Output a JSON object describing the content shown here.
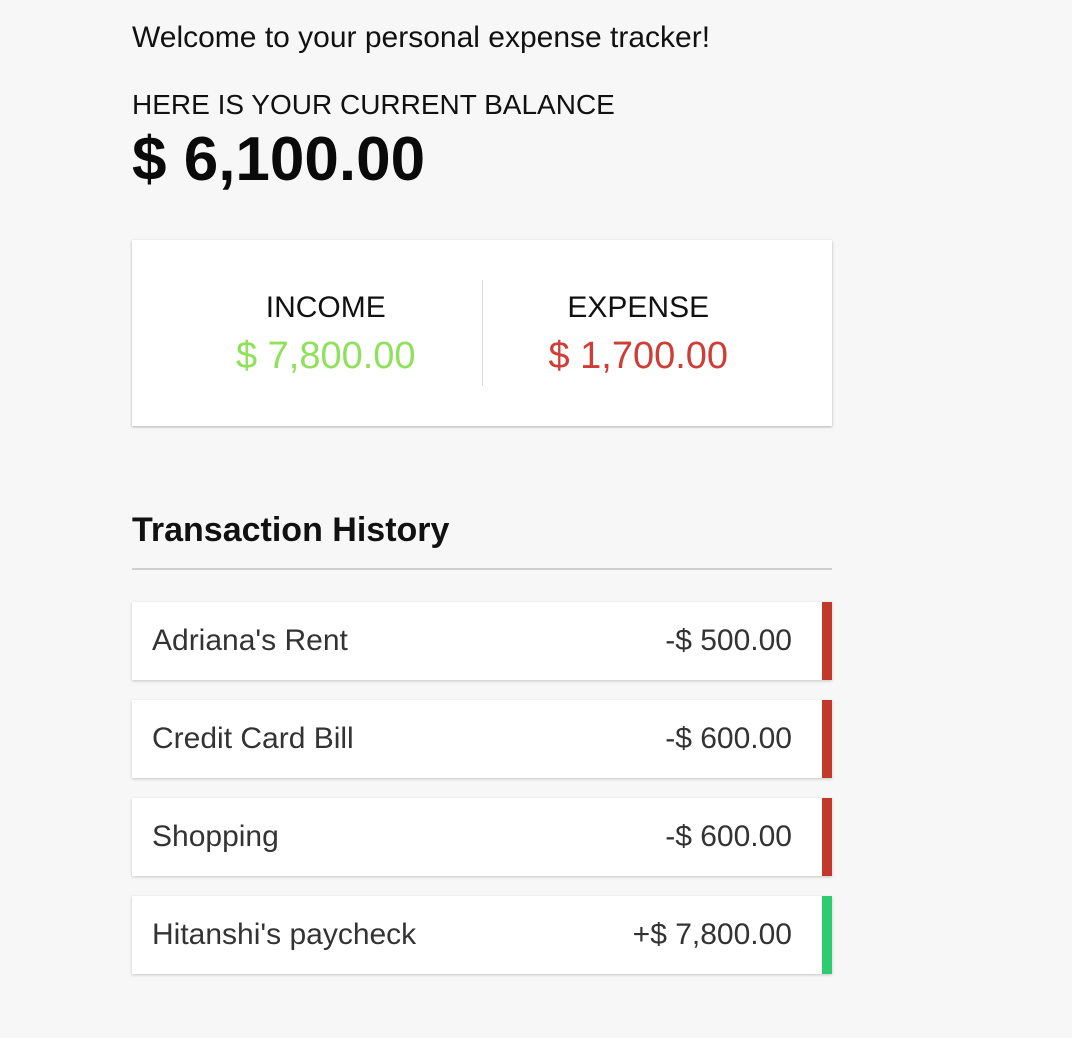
{
  "header": {
    "welcome": "Welcome to your personal expense tracker!",
    "balance_label": "HERE IS YOUR CURRENT BALANCE",
    "balance_amount": "$ 6,100.00"
  },
  "summary": {
    "income_label": "INCOME",
    "income_value": "$ 7,800.00",
    "expense_label": "EXPENSE",
    "expense_value": "$ 1,700.00"
  },
  "history": {
    "title": "Transaction History",
    "items": [
      {
        "name": "Adriana's Rent",
        "amount": "-$ 500.00",
        "kind": "minus"
      },
      {
        "name": "Credit Card Bill",
        "amount": "-$ 600.00",
        "kind": "minus"
      },
      {
        "name": "Shopping",
        "amount": "-$ 600.00",
        "kind": "minus"
      },
      {
        "name": "Hitanshi's paycheck",
        "amount": "+$ 7,800.00",
        "kind": "plus"
      }
    ]
  },
  "colors": {
    "income": "#8fe05a",
    "expense": "#cf3e36",
    "minus_marker": "#c0392b",
    "plus_marker": "#2ecc71"
  }
}
